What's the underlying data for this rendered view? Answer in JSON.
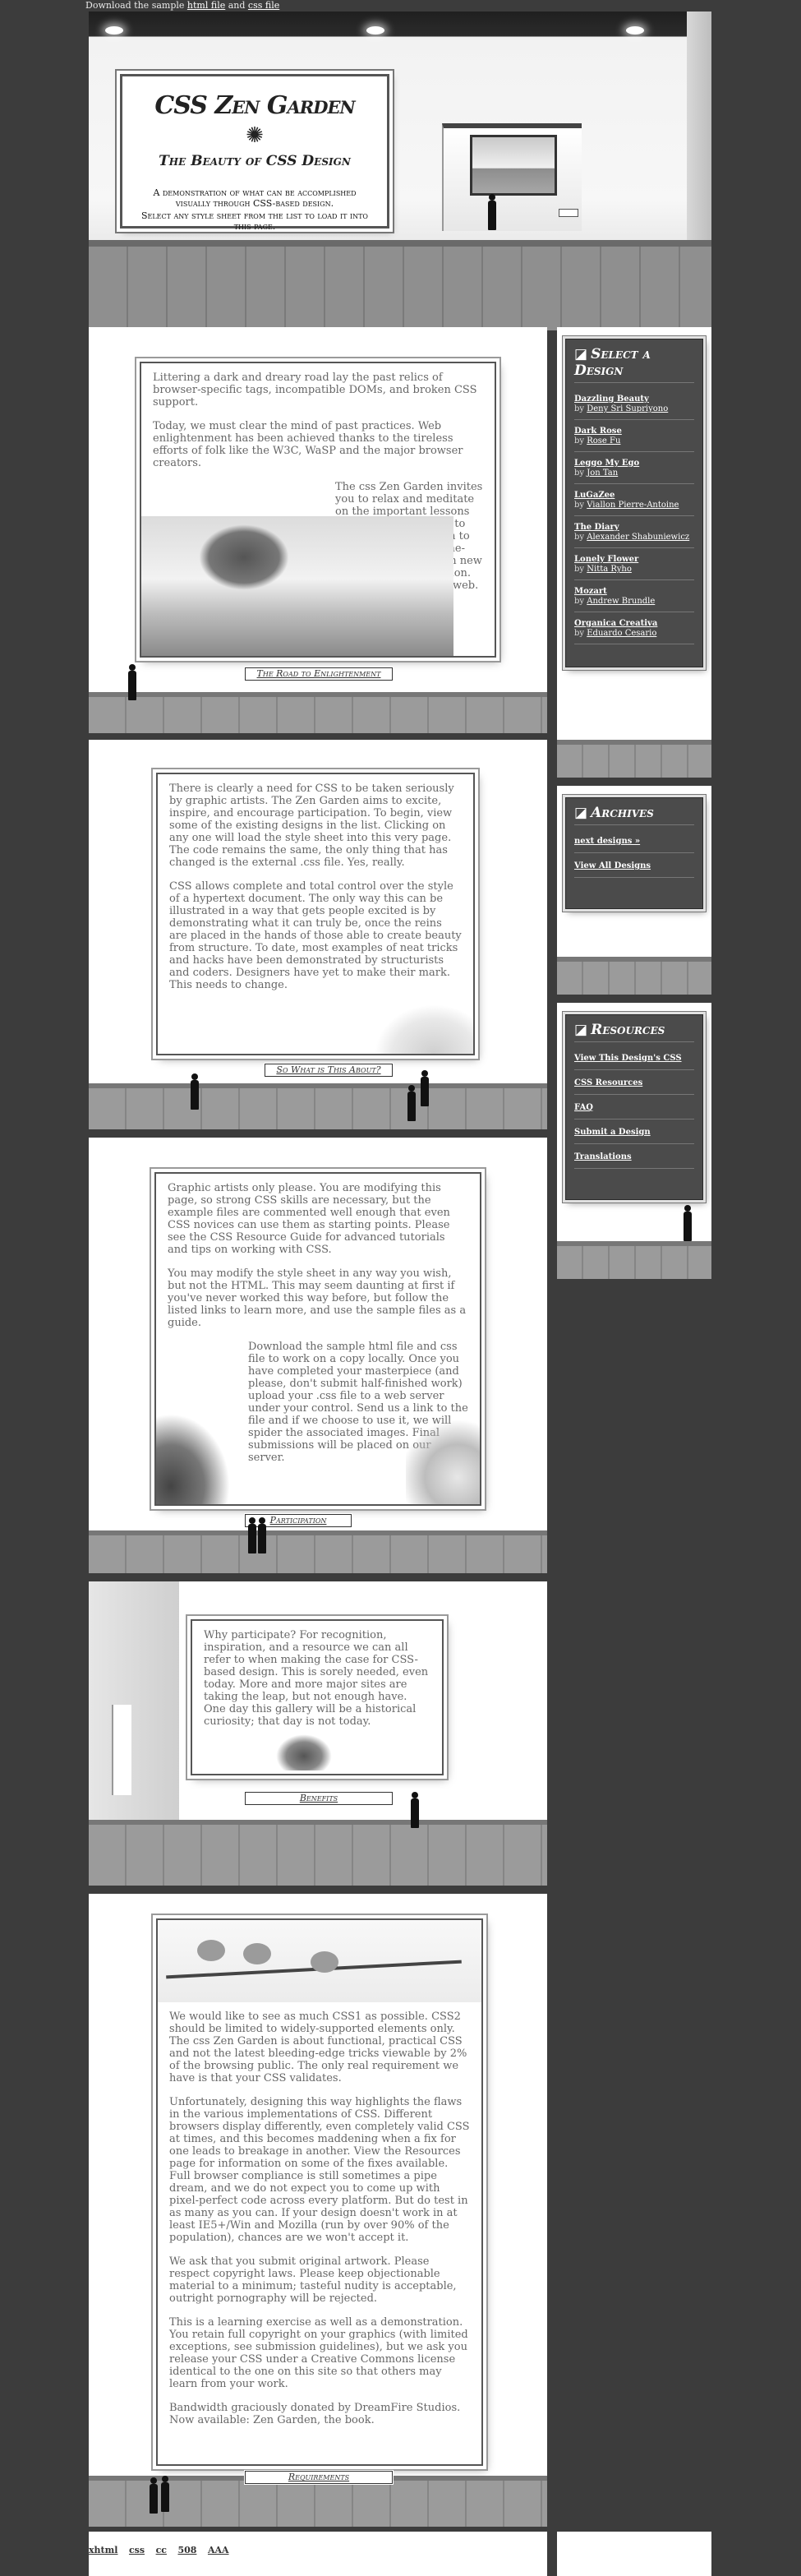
{
  "top_links": {
    "prefix": "Download the sample",
    "html_file": "html file",
    "and": "and",
    "css_file": "css file"
  },
  "header": {
    "title": "CSS Zen Garden",
    "subtitle": "The Beauty of CSS Design",
    "summary": "A demonstration of what can be accomplished visually through CSS-based design.",
    "preamble": "Select any style sheet from the list to load it into this page."
  },
  "sections": {
    "road": {
      "plaque": "The Road to Enlightenment",
      "p1": "Littering a dark and dreary road lay the past relics of browser-specific tags, incompatible DOMs, and broken CSS support.",
      "p2": "Today, we must clear the mind of past practices. Web enlightenment has been achieved thanks to the tireless efforts of folk like the W3C, WaSP and the major browser creators.",
      "p3": "The css Zen Garden invites you to relax and meditate on the important lessons of the masters. Begin to see with clarity. Learn to use the (yet to be) time-honored techniques in new and invigorating fashion. Become one with the web."
    },
    "about": {
      "plaque": "So What is This About?",
      "p1": "There is clearly a need for CSS to be taken seriously by graphic artists. The Zen Garden aims to excite, inspire, and encourage participation. To begin, view some of the existing designs in the list. Clicking on any one will load the style sheet into this very page. The code remains the same, the only thing that has changed is the external .css file. Yes, really.",
      "p2": "CSS allows complete and total control over the style of a hypertext document. The only way this can be illustrated in a way that gets people excited is by demonstrating what it can truly be, once the reins are placed in the hands of those able to create beauty from structure. To date, most examples of neat tricks and hacks have been demonstrated by structurists and coders. Designers have yet to make their mark. This needs to change."
    },
    "participation": {
      "plaque": "Participation",
      "p1": "Graphic artists only please. You are modifying this page, so strong CSS skills are necessary, but the example files are commented well enough that even CSS novices can use them as starting points. Please see the CSS Resource Guide for advanced tutorials and tips on working with CSS.",
      "p2": "You may modify the style sheet in any way you wish, but not the HTML. This may seem daunting at first if you've never worked this way before, but follow the listed links to learn more, and use the sample files as a guide.",
      "p3": "Download the sample html file and css file to work on a copy locally. Once you have completed your masterpiece (and please, don't submit half-finished work) upload your .css file to a web server under your control. Send us a link to the file and if we choose to use it, we will spider the associated images. Final submissions will be placed on our server."
    },
    "benefits": {
      "plaque": "Benefits",
      "p1": "Why participate? For recognition, inspiration, and a resource we can all refer to when making the case for CSS-based design. This is sorely needed, even today. More and more major sites are taking the leap, but not enough have. One day this gallery will be a historical curiosity; that day is not today."
    },
    "requirements": {
      "plaque": "Requirements",
      "p1": "We would like to see as much CSS1 as possible. CSS2 should be limited to widely-supported elements only. The css Zen Garden is about functional, practical CSS and not the latest bleeding-edge tricks viewable by 2% of the browsing public. The only real requirement we have is that your CSS validates.",
      "p2": "Unfortunately, designing this way highlights the flaws in the various implementations of CSS. Different browsers display differently, even completely valid CSS at times, and this becomes maddening when a fix for one leads to breakage in another. View the Resources page for information on some of the fixes available. Full browser compliance is still sometimes a pipe dream, and we do not expect you to come up with pixel-perfect code across every platform. But do test in as many as you can. If your design doesn't work in at least IE5+/Win and Mozilla (run by over 90% of the population), chances are we won't accept it.",
      "p3": "We ask that you submit original artwork. Please respect copyright laws. Please keep objectionable material to a minimum; tasteful nudity is acceptable, outright pornography will be rejected.",
      "p4": "This is a learning exercise as well as a demonstration. You retain full copyright on your graphics (with limited exceptions, see submission guidelines), but we ask you release your CSS under a Creative Commons license identical to the one on this site so that others may learn from your work.",
      "p5": "Bandwidth graciously donated by DreamFire Studios. Now available: Zen Garden, the book."
    }
  },
  "sidebar": {
    "select": {
      "heading": "Select a Design",
      "designs": [
        {
          "name": "Dazzling Beauty",
          "by": "by",
          "designer": "Deny Sri Supriyono"
        },
        {
          "name": "Dark Rose",
          "by": "by",
          "designer": "Rose Fu"
        },
        {
          "name": "Leggo My Ego",
          "by": "by",
          "designer": "Jon Tan"
        },
        {
          "name": "LuGaZee",
          "by": "by",
          "designer": "Viallon Pierre-Antoine"
        },
        {
          "name": "The Diary",
          "by": "by",
          "designer": "Alexander Shabuniewicz"
        },
        {
          "name": "Lonely Flower",
          "by": "by",
          "designer": "Nitta Ryho"
        },
        {
          "name": "Mozart",
          "by": "by",
          "designer": "Andrew Brundle"
        },
        {
          "name": "Organica Creativa",
          "by": "by",
          "designer": "Eduardo Cesario"
        }
      ]
    },
    "archives": {
      "heading": "Archives",
      "links": [
        "next designs »",
        "View All Designs"
      ]
    },
    "resources": {
      "heading": "Resources",
      "links": [
        "View This Design's CSS",
        "CSS Resources",
        "FAQ",
        "Submit a Design",
        "Translations"
      ]
    }
  },
  "footer": {
    "links": [
      "xhtml",
      "css",
      "cc",
      "508",
      "AAA"
    ]
  }
}
